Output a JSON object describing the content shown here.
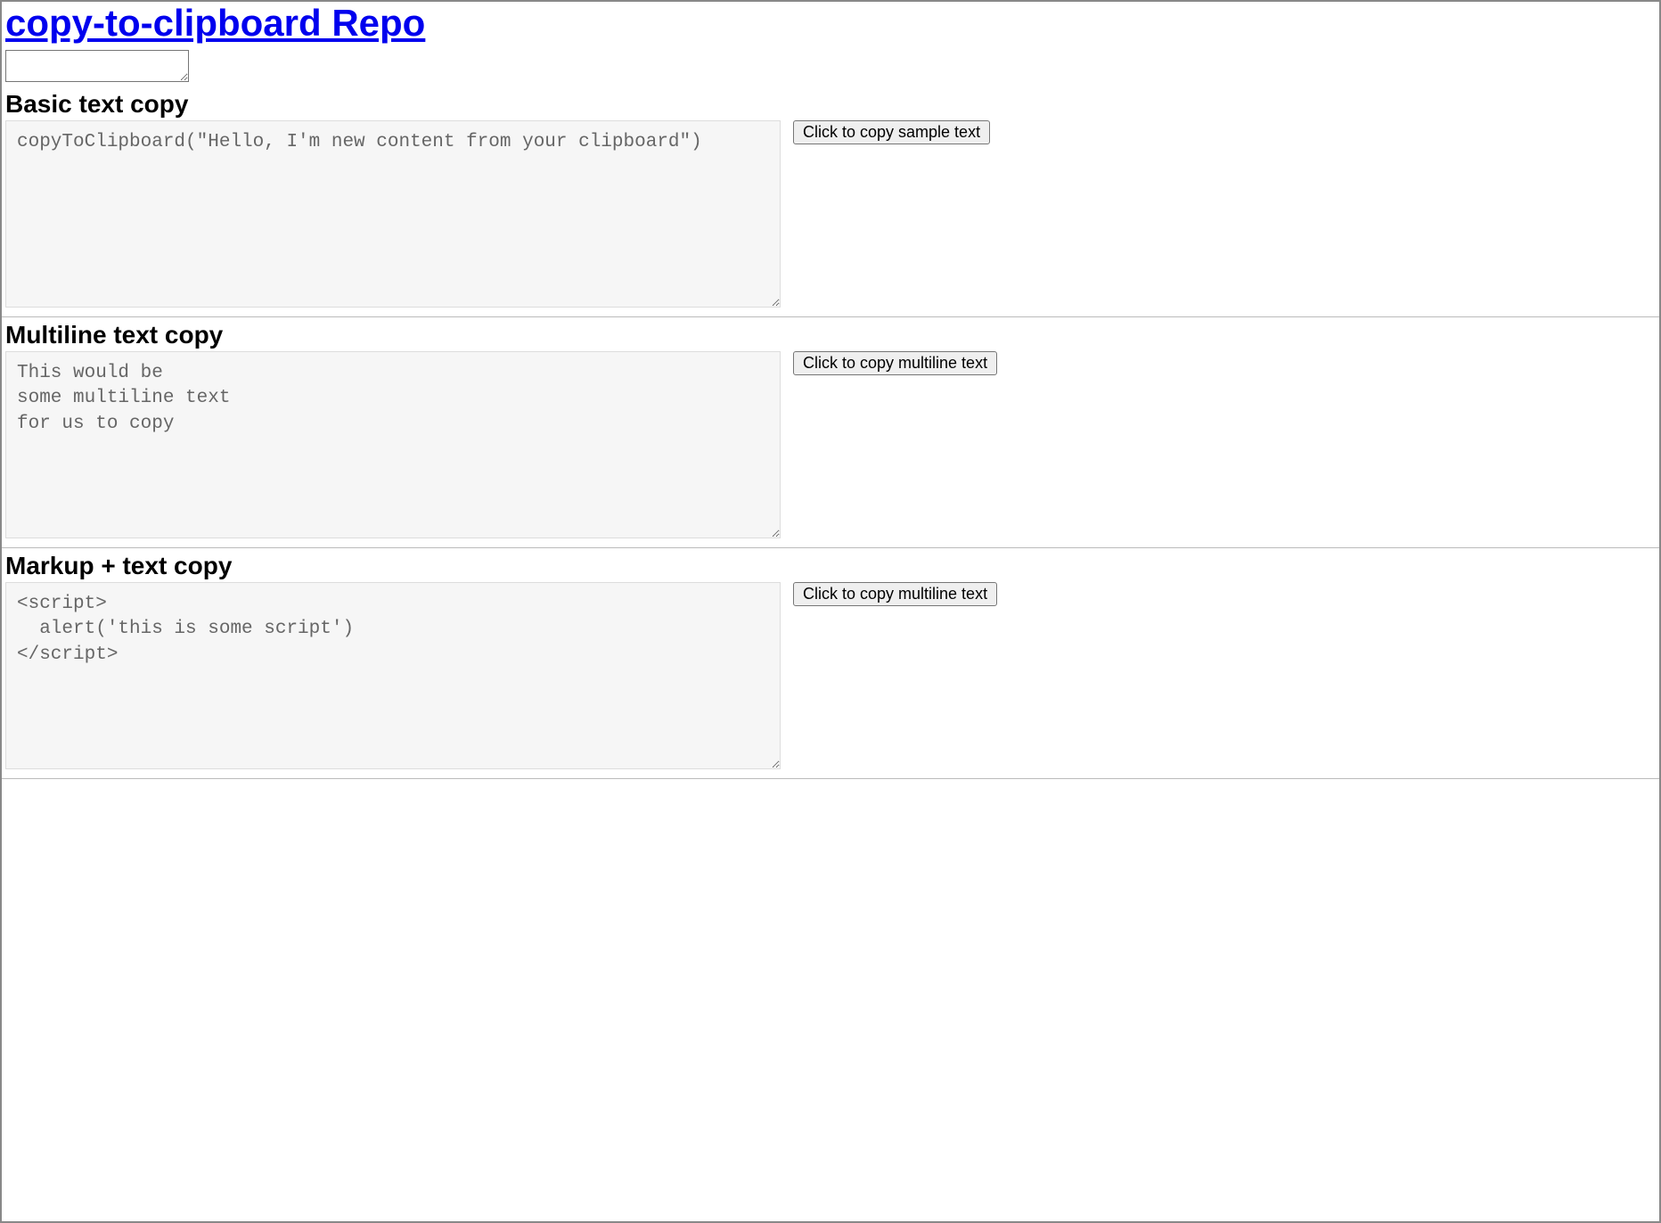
{
  "header": {
    "title": "copy-to-clipboard Repo"
  },
  "sections": [
    {
      "heading": "Basic text copy",
      "code": "copyToClipboard(\"Hello, I'm new content from your clipboard\")",
      "button_label": "Click to copy sample text"
    },
    {
      "heading": "Multiline text copy",
      "code": "This would be\nsome multiline text\nfor us to copy",
      "button_label": "Click to copy multiline text"
    },
    {
      "heading": "Markup + text copy",
      "code": "<script>\n  alert('this is some script')\n</script>",
      "button_label": "Click to copy multiline text"
    }
  ]
}
